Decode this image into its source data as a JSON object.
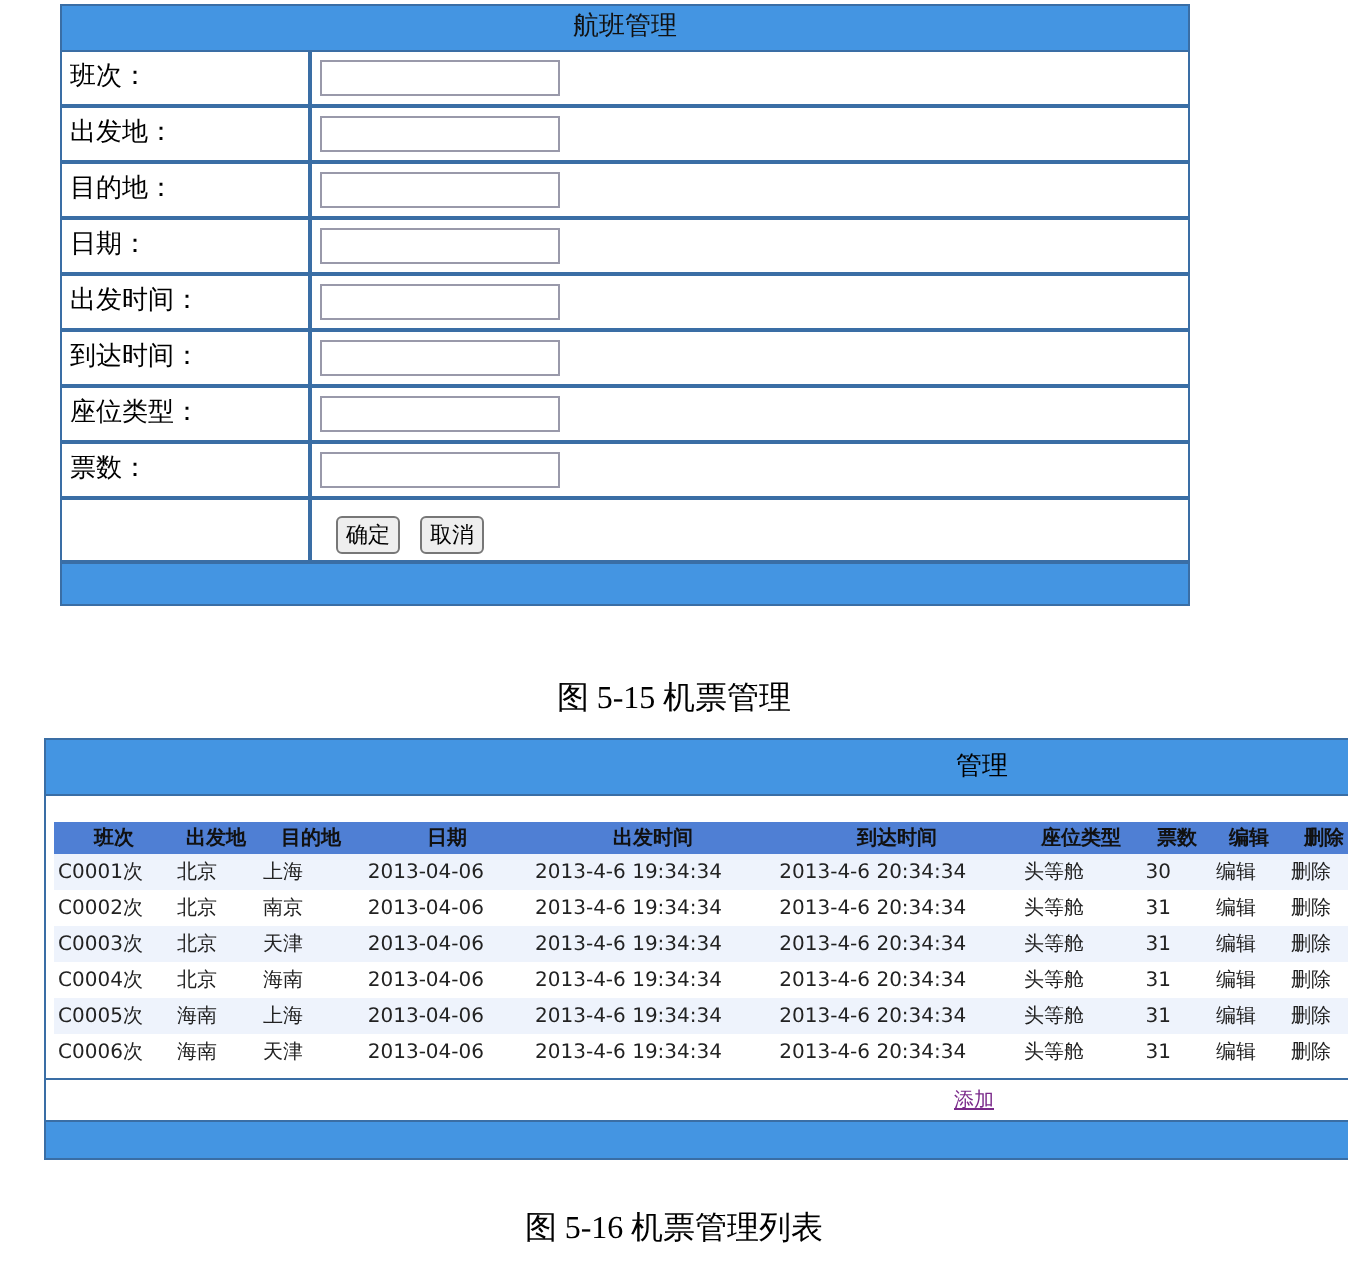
{
  "form_panel": {
    "title": "航班管理",
    "fields": [
      {
        "label": "班次："
      },
      {
        "label": "出发地："
      },
      {
        "label": "目的地："
      },
      {
        "label": "日期："
      },
      {
        "label": "出发时间："
      },
      {
        "label": "到达时间："
      },
      {
        "label": "座位类型："
      },
      {
        "label": "票数："
      }
    ],
    "buttons": [
      "确定",
      "取消"
    ]
  },
  "caption_1": "图 5-15 机票管理",
  "list_panel": {
    "title": "管理",
    "columns": [
      "班次",
      "出发地",
      "目的地",
      "日期",
      "出发时间",
      "到达时间",
      "座位类型",
      "票数",
      "编辑",
      "删除"
    ],
    "rows": [
      [
        "C0001次",
        "北京",
        "上海",
        "2013-04-06",
        "2013-4-6 19:34:34",
        "2013-4-6 20:34:34",
        "头等舱",
        "30",
        "编辑",
        "删除"
      ],
      [
        "C0002次",
        "北京",
        "南京",
        "2013-04-06",
        "2013-4-6 19:34:34",
        "2013-4-6 20:34:34",
        "头等舱",
        "31",
        "编辑",
        "删除"
      ],
      [
        "C0003次",
        "北京",
        "天津",
        "2013-04-06",
        "2013-4-6 19:34:34",
        "2013-4-6 20:34:34",
        "头等舱",
        "31",
        "编辑",
        "删除"
      ],
      [
        "C0004次",
        "北京",
        "海南",
        "2013-04-06",
        "2013-4-6 19:34:34",
        "2013-4-6 20:34:34",
        "头等舱",
        "31",
        "编辑",
        "删除"
      ],
      [
        "C0005次",
        "海南",
        "上海",
        "2013-04-06",
        "2013-4-6 19:34:34",
        "2013-4-6 20:34:34",
        "头等舱",
        "31",
        "编辑",
        "删除"
      ],
      [
        "C0006次",
        "海南",
        "天津",
        "2013-04-06",
        "2013-4-6 19:34:34",
        "2013-4-6 20:34:34",
        "头等舱",
        "31",
        "编辑",
        "删除"
      ]
    ],
    "add_link": "添加"
  },
  "caption_2": "图 5-16 机票管理列表"
}
